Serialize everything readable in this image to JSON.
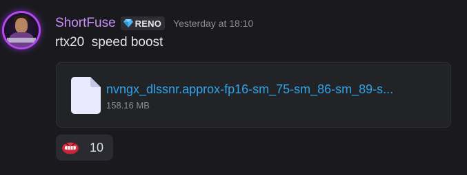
{
  "message": {
    "author": {
      "username": "ShortFuse",
      "username_color": "#c58ff5",
      "avatar_icon": "user-avatar",
      "avatar_ring_color": "#b648f0",
      "tag": {
        "icon": "diamond-gem-icon",
        "label": "RENO"
      }
    },
    "timestamp": "Yesterday at 18:10",
    "content": "rtx20  speed boost",
    "attachment": {
      "icon": "file-icon",
      "filename": "nvngx_dlssnr.approx-fp16-sm_75-sm_86-sm_89-s...",
      "size": "158.16 MB",
      "link_color": "#2fa3e9"
    },
    "reactions": [
      {
        "emoji": "red-angry-face-emoji",
        "count": "10"
      }
    ]
  }
}
